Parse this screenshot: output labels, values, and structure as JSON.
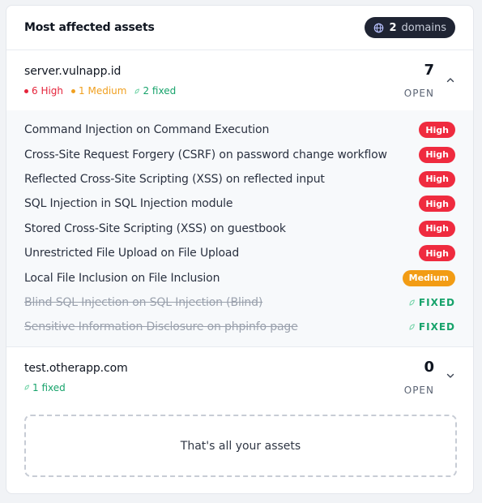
{
  "card": {
    "title": "Most affected assets",
    "domains_count": "2",
    "domains_label": "domains"
  },
  "assets": [
    {
      "name": "server.vulnapp.id",
      "stats": {
        "high": "6 High",
        "medium": "1 Medium",
        "fixed": "2 fixed"
      },
      "open_count": "7",
      "open_label": "OPEN",
      "expanded": true,
      "vulns": [
        {
          "title": "Command Injection on Command Execution",
          "status": "High"
        },
        {
          "title": "Cross-Site Request Forgery (CSRF) on password change workflow",
          "status": "High"
        },
        {
          "title": "Reflected Cross-Site Scripting (XSS) on reflected input",
          "status": "High"
        },
        {
          "title": "SQL Injection in SQL Injection module",
          "status": "High"
        },
        {
          "title": "Stored Cross-Site Scripting (XSS) on guestbook",
          "status": "High"
        },
        {
          "title": "Unrestricted File Upload on File Upload",
          "status": "High"
        },
        {
          "title": "Local File Inclusion on File Inclusion",
          "status": "Medium"
        },
        {
          "title": "Blind SQL Injection on SQL Injection (Blind)",
          "status": "FIXED"
        },
        {
          "title": "Sensitive Information Disclosure on phpinfo page",
          "status": "FIXED"
        }
      ]
    },
    {
      "name": "test.otherapp.com",
      "stats": {
        "fixed": "1 fixed"
      },
      "open_count": "0",
      "open_label": "OPEN",
      "expanded": false
    }
  ],
  "end_message": "That's all your assets",
  "colors": {
    "high": "#ef2b3f",
    "medium": "#f29c14",
    "fixed": "#17a36b",
    "pill_bg": "#1f2433"
  },
  "icons": {
    "domains": "globe-icon",
    "expanded": "chevron-up-icon",
    "collapsed": "chevron-down-icon",
    "fixed": "leaf-icon"
  }
}
